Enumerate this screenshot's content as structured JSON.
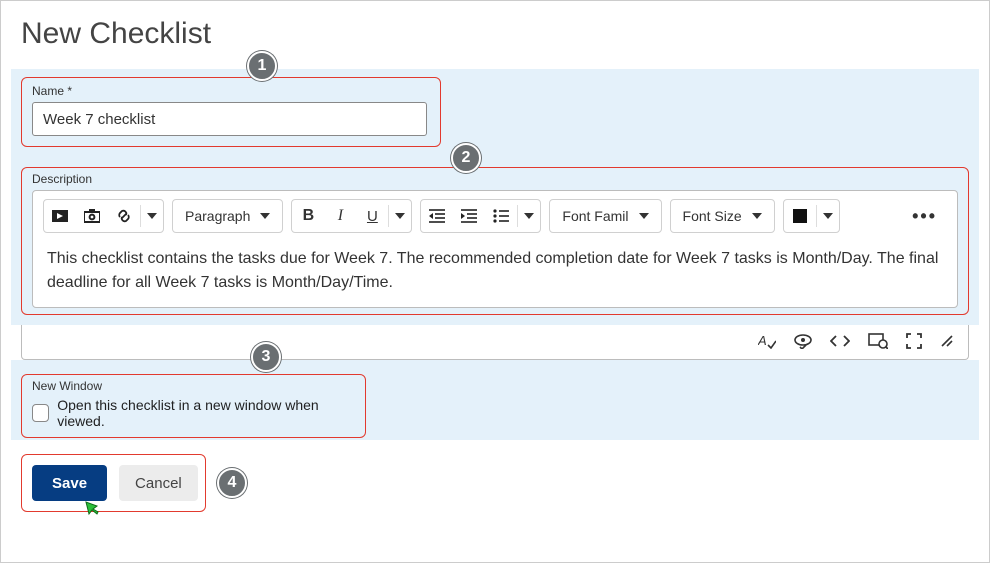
{
  "page": {
    "title": "New Checklist"
  },
  "name_field": {
    "label": "Name *",
    "value": "Week 7 checklist"
  },
  "description_field": {
    "label": "Description",
    "body": "This checklist contains the tasks due for Week 7. The recommended completion date for Week 7 tasks is Month/Day. The final deadline for all Week 7 tasks is Month/Day/Time."
  },
  "toolbar": {
    "paragraph_label": "Paragraph",
    "font_family_label": "Font Famil",
    "font_size_label": "Font Size",
    "more_label": "•••"
  },
  "new_window": {
    "label": "New Window",
    "checkbox_label": "Open this checklist in a new window when viewed.",
    "checked": false
  },
  "actions": {
    "save_label": "Save",
    "cancel_label": "Cancel"
  },
  "callouts": {
    "c1": "1",
    "c2": "2",
    "c3": "3",
    "c4": "4"
  }
}
